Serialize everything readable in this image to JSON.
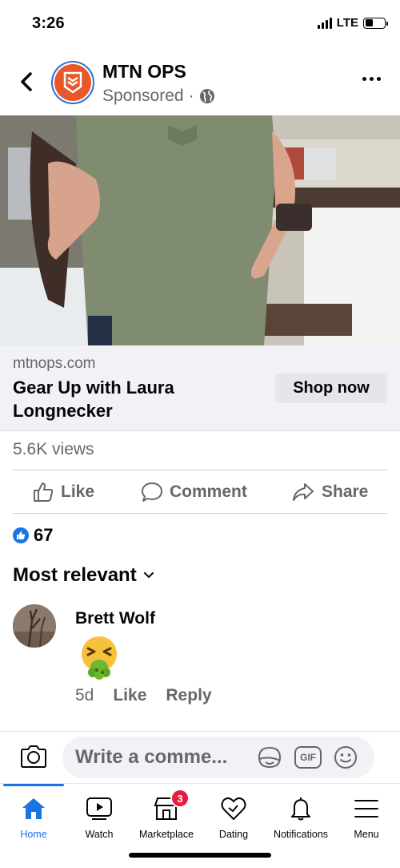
{
  "status_bar": {
    "time": "3:26",
    "network": "LTE"
  },
  "post": {
    "page_name": "MTN OPS",
    "sponsored_label": "Sponsored",
    "separator": "·",
    "link": {
      "domain": "mtnops.com",
      "headline": "Gear Up with Laura Longnecker",
      "cta": "Shop now"
    },
    "views": "5.6K views",
    "actions": {
      "like": "Like",
      "comment": "Comment",
      "share": "Share"
    },
    "reaction_count": "67"
  },
  "comments": {
    "sort_label": "Most relevant",
    "items": [
      {
        "author": "Brett Wolf",
        "time": "5d",
        "like": "Like",
        "reply": "Reply",
        "content_icon": "vomiting-face-emoji"
      }
    ]
  },
  "composer": {
    "placeholder": "Write a comme...",
    "gif": "GIF"
  },
  "tabs": [
    {
      "label": "Home",
      "icon": "home-icon",
      "active": true
    },
    {
      "label": "Watch",
      "icon": "watch-icon"
    },
    {
      "label": "Marketplace",
      "icon": "marketplace-icon",
      "badge": "3"
    },
    {
      "label": "Dating",
      "icon": "dating-heart-icon"
    },
    {
      "label": "Notifications",
      "icon": "bell-icon"
    },
    {
      "label": "Menu",
      "icon": "menu-icon"
    }
  ],
  "colors": {
    "accent": "#1b74e4",
    "badge": "#e41e3f",
    "brand": "#e8582a",
    "muted": "#65676b"
  }
}
